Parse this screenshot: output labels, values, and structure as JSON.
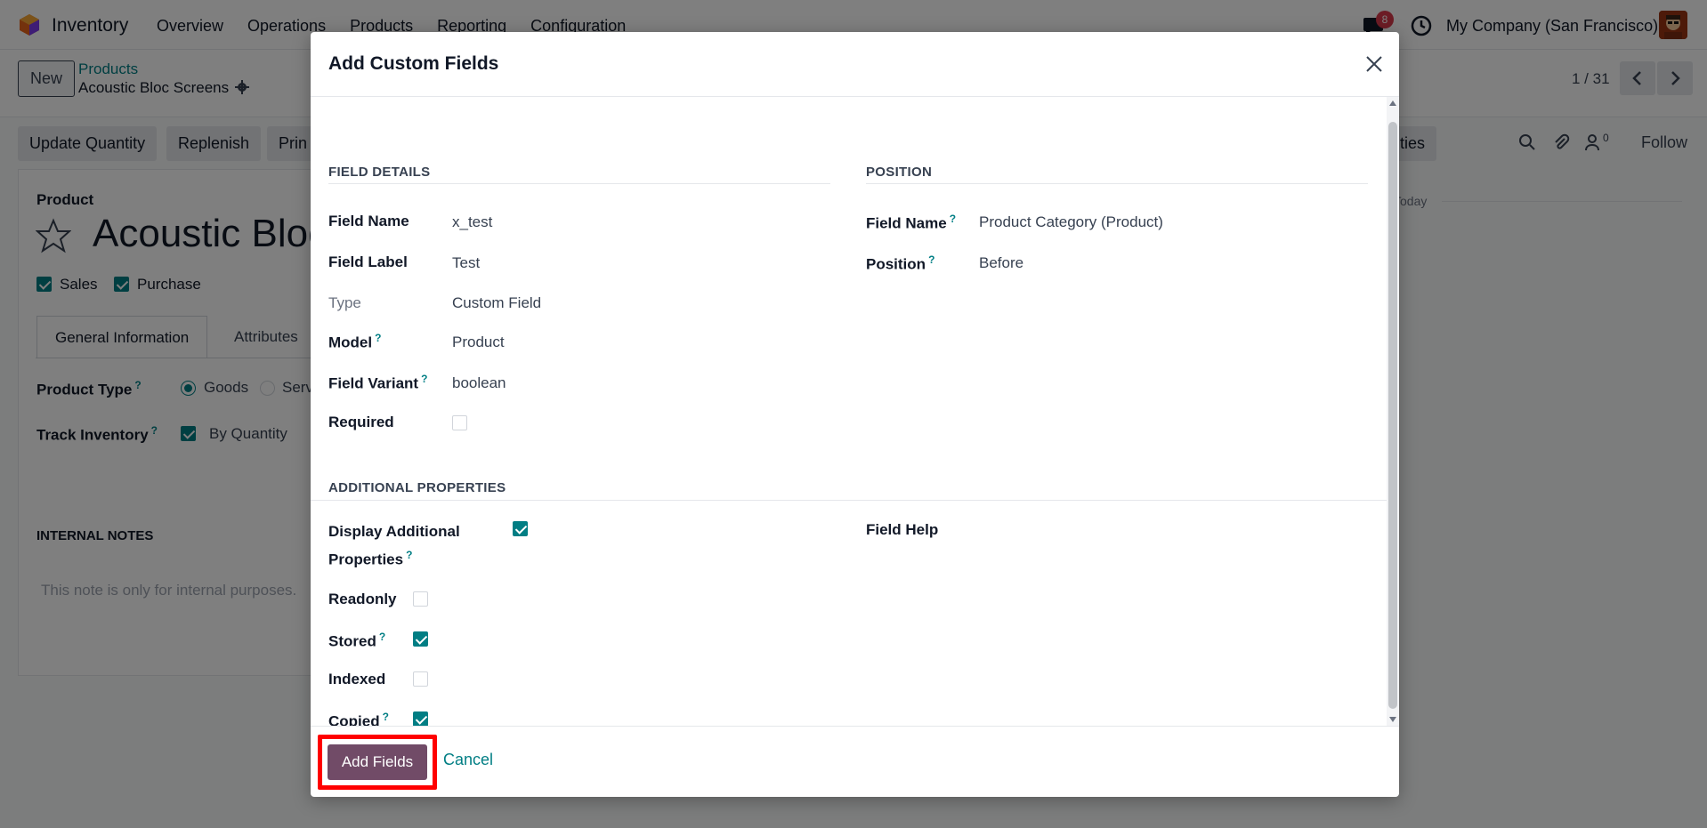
{
  "navbar": {
    "app_name": "Inventory",
    "menu": [
      "Overview",
      "Operations",
      "Products",
      "Reporting",
      "Configuration"
    ],
    "notifications_count": "8",
    "company": "My Company (San Francisco)"
  },
  "control": {
    "new_label": "New",
    "breadcrumb_parent": "Products",
    "breadcrumb_current": "Acoustic Bloc Screens",
    "pager": "1 / 31"
  },
  "actions": {
    "update_quantity": "Update Quantity",
    "replenish": "Replenish",
    "print_partial": "Prin",
    "partial_right": "ties",
    "follow": "Follow",
    "followers_count": "0",
    "today": "Today"
  },
  "product": {
    "section_label": "Product",
    "title_partial": "Acoustic Bloc",
    "sales_label": "Sales",
    "purchase_label": "Purchase",
    "tab_general": "General Information",
    "tab_attributes": "Attributes",
    "product_type_label": "Product Type",
    "goods_label": "Goods",
    "services_partial": "Serv",
    "track_inventory_label": "Track Inventory",
    "by_quantity_label": "By Quantity",
    "internal_notes_title": "INTERNAL NOTES",
    "internal_notes_placeholder": "This note is only for internal purposes."
  },
  "modal": {
    "title": "Add Custom Fields",
    "field_details": {
      "title": "FIELD DETAILS",
      "field_name_label": "Field Name",
      "field_name_value": "x_test",
      "field_label_label": "Field Label",
      "field_label_value": "Test",
      "type_label": "Type",
      "type_value": "Custom Field",
      "model_label": "Model",
      "model_value": "Product",
      "variant_label": "Field Variant",
      "variant_value": "boolean",
      "required_label": "Required",
      "required_checked": false
    },
    "position": {
      "title": "POSITION",
      "field_name_label": "Field Name",
      "field_name_value": "Product Category (Product)",
      "position_label": "Position",
      "position_value": "Before"
    },
    "additional": {
      "title": "ADDITIONAL PROPERTIES",
      "display_label_line1": "Display Additional",
      "display_label_line2": "Properties",
      "display_checked": true,
      "field_help_label": "Field Help",
      "readonly_label": "Readonly",
      "readonly_checked": false,
      "stored_label": "Stored",
      "stored_checked": true,
      "indexed_label": "Indexed",
      "indexed_checked": false,
      "copied_label": "Copied",
      "copied_checked": true
    },
    "footer": {
      "add_label": "Add Fields",
      "cancel_label": "Cancel"
    },
    "help_marker": "?"
  },
  "colors": {
    "primary": "#714b67",
    "accent": "#017e84",
    "highlight": "#ff0000",
    "badge": "#d9394a"
  }
}
